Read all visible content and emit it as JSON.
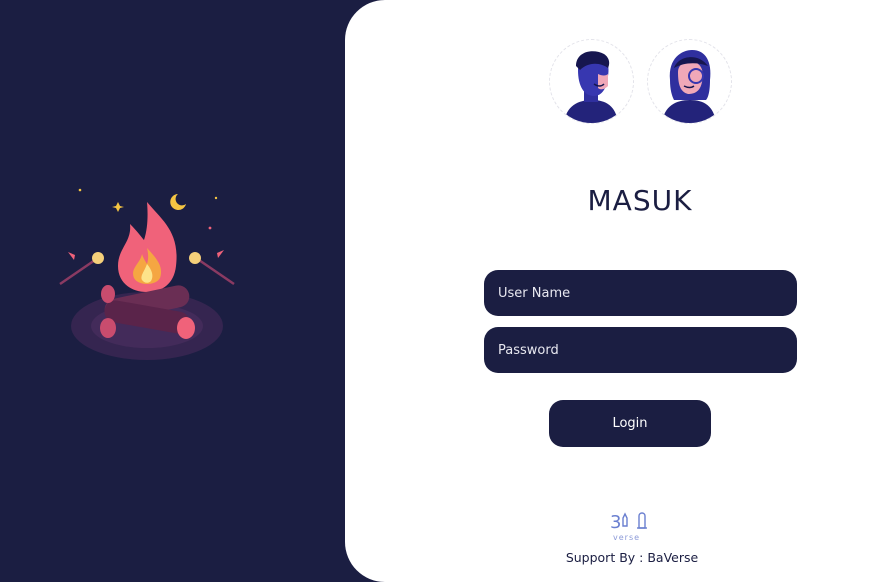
{
  "login": {
    "title": "MASUK",
    "username_placeholder": "User Name",
    "password_placeholder": "Password",
    "login_label": "Login"
  },
  "footer": {
    "logo_icon": "baverse-logo",
    "support_text": "Support By : BaVerse"
  },
  "illustration": {
    "icon": "campfire-illustration"
  },
  "avatars": [
    {
      "icon": "man-avatar-icon"
    },
    {
      "icon": "woman-avatar-icon"
    }
  ],
  "colors": {
    "background": "#1b1e42",
    "panel": "#ffffff",
    "accent_fire": "#f0627a",
    "accent_yellow": "#f5c542",
    "avatar_blue": "#2f2f9e"
  }
}
